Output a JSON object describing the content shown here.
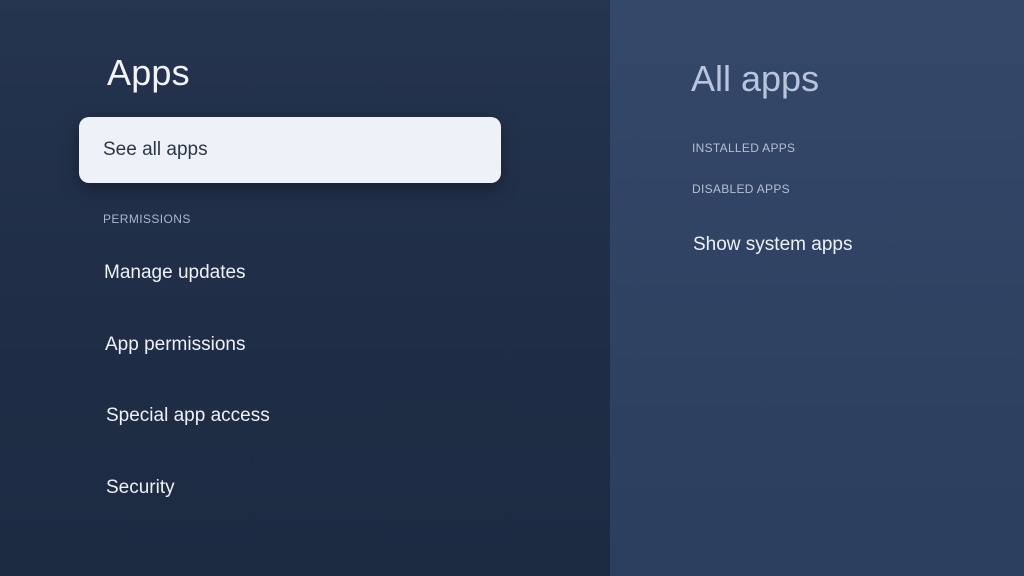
{
  "left_panel": {
    "title": "Apps",
    "focused_item": "See all apps",
    "section_header": "PERMISSIONS",
    "items": [
      {
        "label": "Manage updates"
      },
      {
        "label": "App permissions"
      },
      {
        "label": "Special app access"
      },
      {
        "label": "Security"
      }
    ]
  },
  "right_panel": {
    "title": "All apps",
    "headers": [
      "INSTALLED APPS",
      "DISABLED APPS"
    ],
    "item": "Show system apps"
  },
  "colors": {
    "left_background": "#1f2d46",
    "right_background": "#2f4262",
    "focus_highlight": "#eef1f7"
  }
}
